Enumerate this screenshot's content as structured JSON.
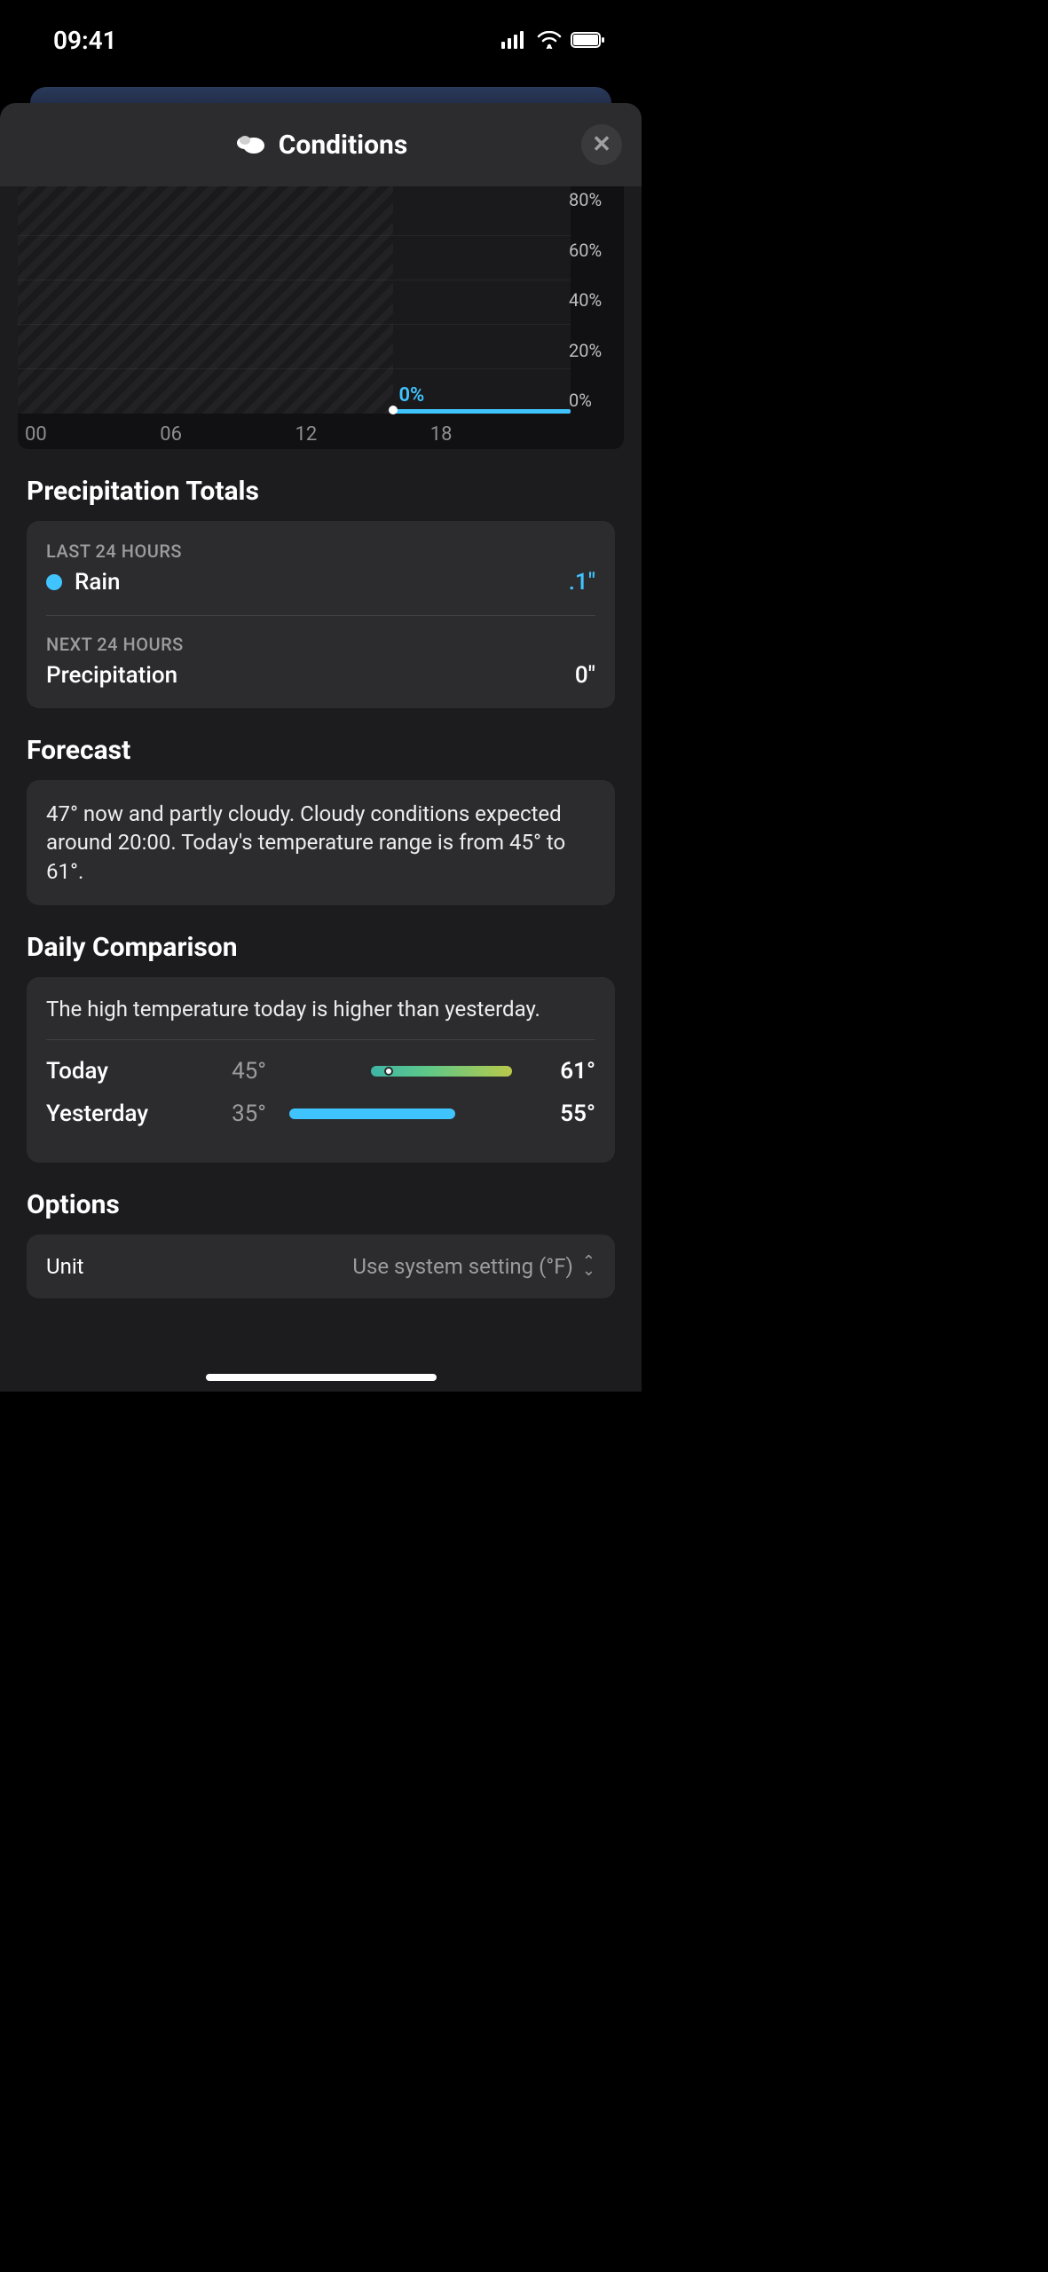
{
  "status_bar": {
    "time": "09:41"
  },
  "header": {
    "title": "Conditions",
    "icon": "clouds-icon"
  },
  "chart_data": {
    "type": "line",
    "title": "",
    "x": [
      "00",
      "06",
      "12",
      "18"
    ],
    "y_ticks": [
      "80%",
      "60%",
      "40%",
      "20%",
      "0%"
    ],
    "ylabel": "",
    "xlabel": "",
    "ylim": [
      0,
      80
    ],
    "now_label": "0%",
    "series": [
      {
        "name": "precipitation_chance_future",
        "x": [
          18,
          19,
          20,
          21,
          22,
          23
        ],
        "values": [
          0,
          0,
          0,
          0,
          0,
          0
        ]
      }
    ]
  },
  "precip_totals": {
    "section_title": "Precipitation Totals",
    "last": {
      "label": "LAST 24 HOURS",
      "name": "Rain",
      "value": ".1\""
    },
    "next": {
      "label": "NEXT 24 HOURS",
      "name": "Precipitation",
      "value": "0\""
    }
  },
  "forecast": {
    "section_title": "Forecast",
    "text": "47° now and partly cloudy. Cloudy conditions expected around 20:00. Today's temperature range is from 45° to 61°."
  },
  "daily_comparison": {
    "section_title": "Daily Comparison",
    "summary": "The high temperature today is higher than yesterday.",
    "rows": [
      {
        "label": "Today",
        "low": "45°",
        "high": "61°"
      },
      {
        "label": "Yesterday",
        "low": "35°",
        "high": "55°"
      }
    ]
  },
  "options": {
    "section_title": "Options",
    "unit_label": "Unit",
    "unit_value": "Use system setting (°F)"
  }
}
